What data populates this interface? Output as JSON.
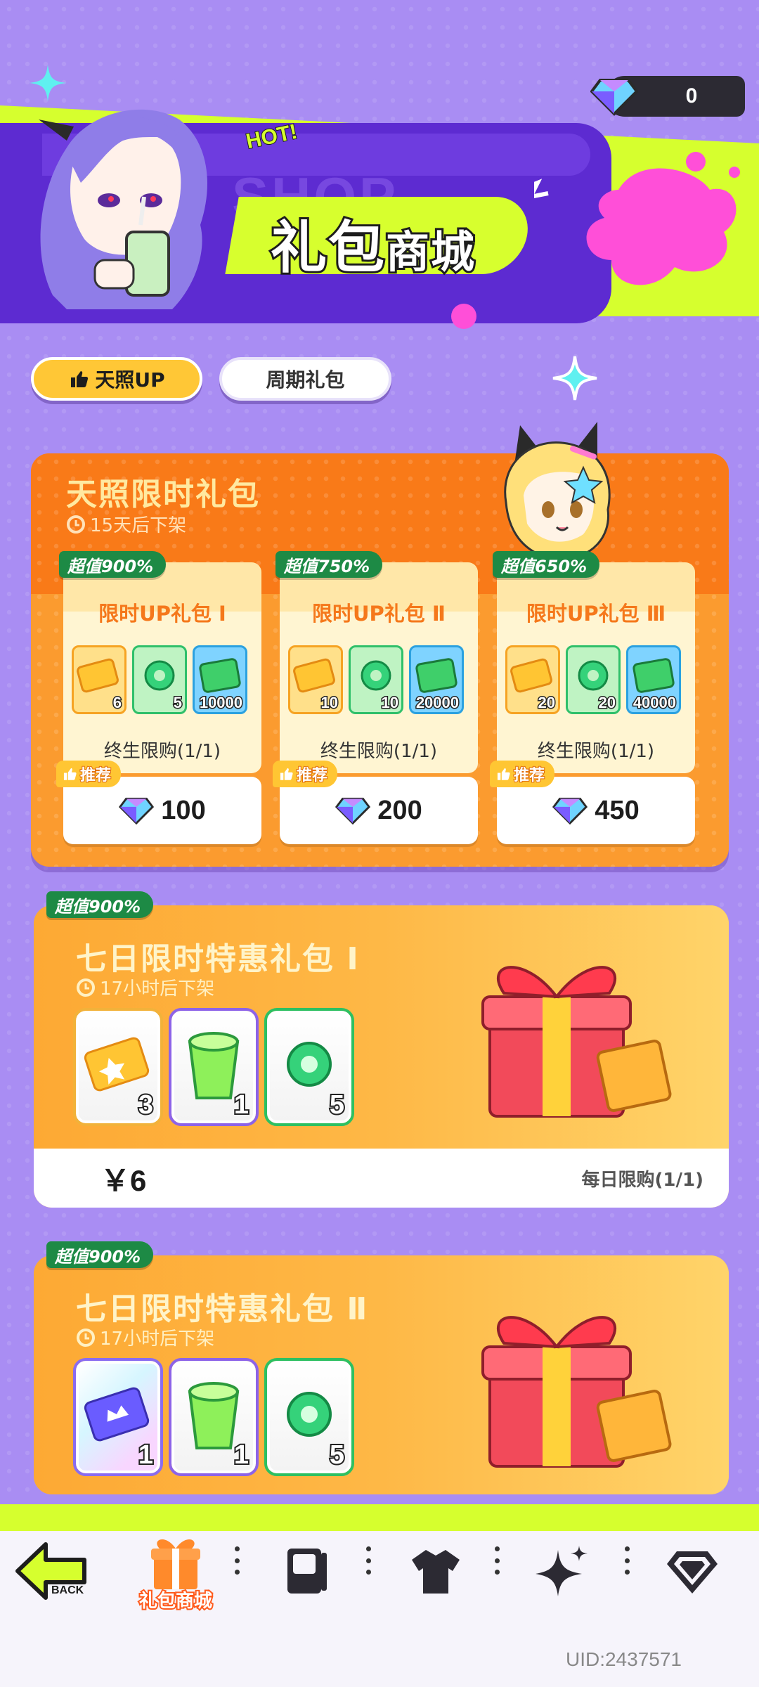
{
  "header": {
    "title_part1": "礼包",
    "title_part2": "商城",
    "hot_label": "HOT!",
    "ghost_label": "SHOP"
  },
  "currency": {
    "icon": "diamond-icon",
    "amount": "0"
  },
  "tabs": [
    {
      "label": "天照UP",
      "icon": "thumbs-up-icon",
      "active": true
    },
    {
      "label": "周期礼包",
      "active": false
    }
  ],
  "limited_section": {
    "title": "天照限时礼包",
    "timer": "15天后下架",
    "cards": [
      {
        "badge": "超值900%",
        "title": "限时UP礼包 Ⅰ",
        "items": [
          "6",
          "5",
          "10000"
        ],
        "limit": "终生限购(1/1)",
        "recommend": "推荐",
        "price": "100"
      },
      {
        "badge": "超值750%",
        "title": "限时UP礼包 Ⅱ",
        "items": [
          "10",
          "10",
          "20000"
        ],
        "limit": "终生限购(1/1)",
        "recommend": "推荐",
        "price": "200"
      },
      {
        "badge": "超值650%",
        "title": "限时UP礼包 Ⅲ",
        "items": [
          "20",
          "20",
          "40000"
        ],
        "limit": "终生限购(1/1)",
        "recommend": "推荐",
        "price": "450"
      }
    ]
  },
  "gift_packs": [
    {
      "badge": "超值900%",
      "title": "七日限时特惠礼包 Ⅰ",
      "timer": "17小时后下架",
      "items": [
        "3",
        "1",
        "5"
      ],
      "price": "￥6",
      "limit": "每日限购(1/1)"
    },
    {
      "badge": "超值900%",
      "title": "七日限时特惠礼包 Ⅱ",
      "timer": "17小时后下架",
      "items": [
        "1",
        "1",
        "5"
      ]
    }
  ],
  "nav": {
    "back_label": "BACK",
    "active_label": "礼包商城",
    "items": [
      "back-icon",
      "gift-icon",
      "card-icon",
      "shirt-icon",
      "sparkle-icon",
      "diamond-icon"
    ]
  },
  "uid": "UID:2437571",
  "colors": {
    "background": "#a98df3",
    "accent_lime": "#d6ff2e",
    "orange": "#fb9b2f",
    "badge_green": "#2fc660"
  }
}
